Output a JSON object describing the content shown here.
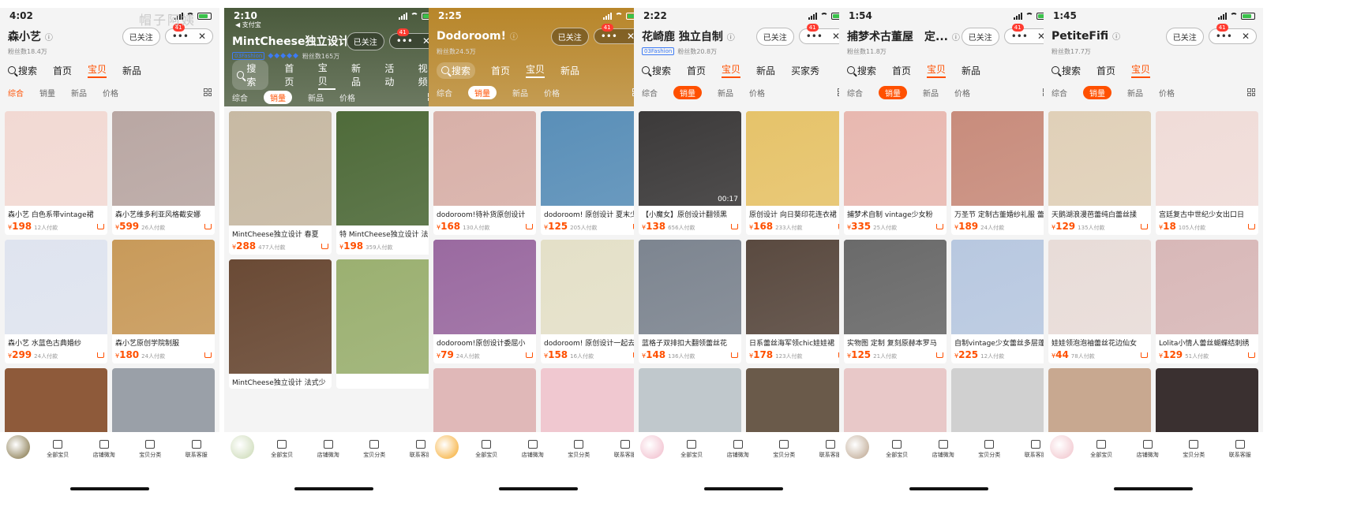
{
  "watermark": "帽子阿姨",
  "phones": [
    {
      "time": "4:02",
      "shop_name": "森小艺",
      "fans": "粉丝数18.4万",
      "follow_label": "已关注",
      "badge": "41",
      "nav": [
        "搜索",
        "首页",
        "宝贝",
        "新品"
      ],
      "sort": [
        "综合",
        "销量",
        "新品",
        "价格"
      ],
      "products": [
        {
          "title": "森小艺 白色系带vintage裙",
          "price": "198",
          "sold": "12人付款"
        },
        {
          "title": "森小艺维多利亚风格截安娜",
          "price": "599",
          "sold": "26人付款"
        },
        {
          "title": "森小艺 水蓝色古典婚纱",
          "price": "299",
          "sold": "24人付款"
        },
        {
          "title": "森小艺原创学院制服",
          "price": "180",
          "sold": "24人付款"
        }
      ],
      "tabbar": [
        "全部宝贝",
        "店铺微淘",
        "宝贝分类",
        "联系客服"
      ]
    },
    {
      "time": "2:10",
      "alipay_back": "◀ 支付宝",
      "shop_name": "MintCheese独立设计",
      "fans": "粉丝数165万",
      "fans_tag": "03Fashion",
      "follow_label": "已关注",
      "badge": "41",
      "nav": [
        "搜索",
        "首页",
        "宝贝",
        "新品",
        "活动",
        "视频"
      ],
      "sort": [
        "综合",
        "销量",
        "新品",
        "价格"
      ],
      "products": [
        {
          "title": "MintCheese独立设计 春夏",
          "price": "288",
          "sold": "477人付款"
        },
        {
          "title": "特 MintCheese独立设计 法",
          "price": "198",
          "sold": "359人付款"
        },
        {
          "title": "MintCheese独立设计 法式少",
          "price": "",
          "sold": ""
        },
        {
          "title": "",
          "price": "",
          "sold": ""
        }
      ],
      "tabbar": [
        "全部宝贝",
        "店铺微淘",
        "宝贝分类",
        "联系客服"
      ]
    },
    {
      "time": "2:25",
      "shop_name": "Dodoroom!",
      "fans": "粉丝数24.5万",
      "follow_label": "已关注",
      "badge": "41",
      "nav": [
        "搜索",
        "首页",
        "宝贝",
        "新品"
      ],
      "sort": [
        "综合",
        "销量",
        "新品",
        "价格"
      ],
      "products": [
        {
          "title": "dodoroom!待补货原创设计",
          "price": "168",
          "sold": "130人付款"
        },
        {
          "title": "dodoroom! 原创设计 夏末少",
          "price": "125",
          "sold": "205人付款"
        },
        {
          "title": "dodoroom!原创设计委屈小",
          "price": "79",
          "sold": "24人付款"
        },
        {
          "title": "dodoroom! 原创设计一起去",
          "price": "158",
          "sold": "16人付款"
        }
      ],
      "tabbar": [
        "全部宝贝",
        "店铺微淘",
        "宝贝分类",
        "联系客服"
      ]
    },
    {
      "time": "2:22",
      "shop_name": "花崎鹿 独立自制",
      "fans": "粉丝数20.8万",
      "fans_tag": "03Fashion",
      "follow_label": "已关注",
      "badge": "41",
      "nav": [
        "搜索",
        "首页",
        "宝贝",
        "新品",
        "买家秀"
      ],
      "sort": [
        "综合",
        "销量",
        "新品",
        "价格"
      ],
      "products": [
        {
          "title": "【小魔女】原创设计翻领黑",
          "price": "138",
          "sold": "656人付款",
          "duration": "00:17"
        },
        {
          "title": "原创设计 向日葵印花连衣裙",
          "price": "168",
          "sold": "233人付款"
        },
        {
          "title": "蓝格子双排扣大翻领蕾丝花",
          "price": "148",
          "sold": "136人付款"
        },
        {
          "title": "日系蕾丝海军领chic娃娃裙",
          "price": "178",
          "sold": "123人付款"
        }
      ],
      "tabbar": [
        "全部宝贝",
        "店铺微淘",
        "宝贝分类",
        "联系客服"
      ]
    },
    {
      "time": "1:54",
      "shop_name": "捕梦术古董屋　定...",
      "fans": "粉丝数11.8万",
      "follow_label": "已关注",
      "badge": "41",
      "nav": [
        "搜索",
        "首页",
        "宝贝",
        "新品"
      ],
      "sort": [
        "综合",
        "销量",
        "新品",
        "价格"
      ],
      "products": [
        {
          "title": "捕梦术自制 vintage少女粉",
          "price": "335",
          "sold": "25人付款"
        },
        {
          "title": "万圣节 定制古董婚纱礼服 蕾",
          "price": "189",
          "sold": "24人付款"
        },
        {
          "title": "实物图 定制 复刻原赫本罗马",
          "price": "125",
          "sold": "21人付款"
        },
        {
          "title": "自制vintage少女蕾丝多层蓬",
          "price": "225",
          "sold": "12人付款"
        }
      ],
      "tabbar": [
        "全部宝贝",
        "店铺微淘",
        "宝贝分类",
        "联系客服"
      ]
    },
    {
      "time": "1:45",
      "shop_name": "PetiteFifi",
      "fans": "粉丝数17.7万",
      "follow_label": "已关注",
      "badge": "41",
      "nav": [
        "搜索",
        "首页",
        "宝贝"
      ],
      "sort": [
        "综合",
        "销量",
        "新品",
        "价格"
      ],
      "products": [
        {
          "title": "天鹅湖浪漫芭蕾纯白蕾丝揉",
          "price": "129",
          "sold": "135人付款"
        },
        {
          "title": "宫廷复古中世纪少女出口日",
          "price": "18",
          "sold": "105人付款"
        },
        {
          "title": "娃娃领泡泡袖蕾丝花边仙女",
          "price": "44",
          "sold": "78人付款"
        },
        {
          "title": "Lolita小情人蕾丝蝴蝶结刺绣",
          "price": "129",
          "sold": "51人付款"
        }
      ],
      "tabbar": [
        "全部宝贝",
        "店铺微淘",
        "宝贝分类",
        "联系客服"
      ]
    }
  ],
  "colors": {
    "accent": "#ff5000",
    "badge": "#ff3b30",
    "link_blue": "#3d7bf5"
  }
}
